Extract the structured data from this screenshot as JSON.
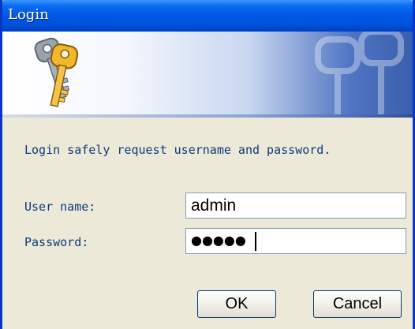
{
  "window": {
    "title": "Login"
  },
  "banner": {
    "icon": "keys-icon",
    "watermark_icon": "keys-watermark-icon"
  },
  "form": {
    "prompt": "Login safely request username and password.",
    "username_label": "User name:",
    "username_value": "admin",
    "password_label": "Password:",
    "password_masked": "●●●●●"
  },
  "buttons": {
    "ok_label": "OK",
    "cancel_label": "Cancel"
  },
  "colors": {
    "titlebar": "#0058e6",
    "label_text": "#0f3a7a",
    "dialog_bg": "#ece9d8",
    "input_border": "#7f9db9"
  }
}
